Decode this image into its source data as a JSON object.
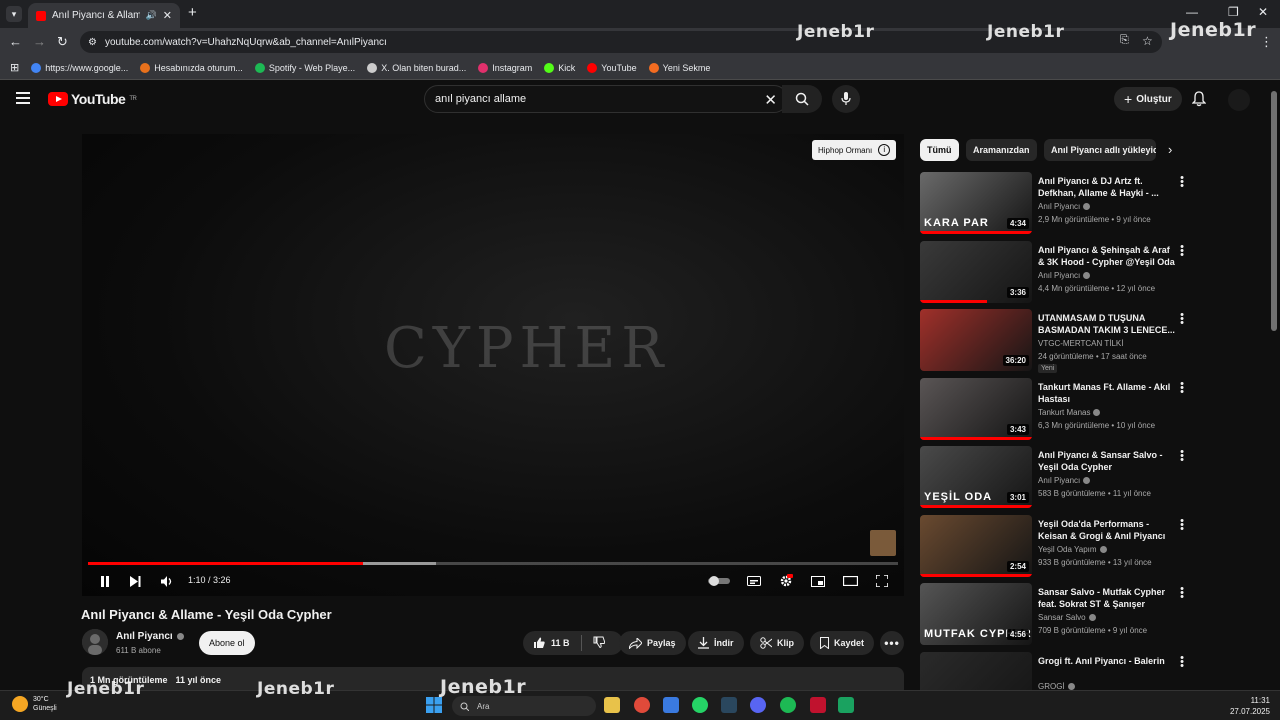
{
  "browser": {
    "tab_title": "Anıl Piyancı & Allame - Yeşi",
    "url": "youtube.com/watch?v=UhahzNqUqrw&ab_channel=AnılPiyancı",
    "bookmarks": [
      {
        "label": "https://www.google...",
        "icon": "google-icon",
        "color": "#4285f4"
      },
      {
        "label": "Hesabınızda oturum...",
        "icon": "office-icon",
        "color": "#e8711c"
      },
      {
        "label": "Spotify - Web Playe...",
        "icon": "spotify-icon",
        "color": "#1db954"
      },
      {
        "label": "X. Olan biten burad...",
        "icon": "x-icon",
        "color": "#cccccc"
      },
      {
        "label": "Instagram",
        "icon": "instagram-icon",
        "color": "#e1306c"
      },
      {
        "label": "Kick",
        "icon": "kick-icon",
        "color": "#53fc18"
      },
      {
        "label": "YouTube",
        "icon": "youtube-icon",
        "color": "#ff0000"
      },
      {
        "label": "Yeni Sekme",
        "icon": "hb-icon",
        "color": "#f36c21"
      }
    ]
  },
  "watermark": "Jeneb1r",
  "youtube": {
    "logo_text": "YouTube",
    "logo_region": "TR",
    "search_value": "anıl piyancı allame",
    "create_label": "Oluştur"
  },
  "player": {
    "overlay_text": "CYPHER",
    "chip_label": "Hiphop Ormanı",
    "time_current": "1:10",
    "time_total": "3:26",
    "played_fraction": 0.34,
    "buffered_fraction": 0.43
  },
  "video": {
    "title": "Anıl Piyancı & Allame - Yeşil Oda Cypher",
    "channel": "Anıl Piyancı",
    "subscribers": "611 B abone",
    "subscribe_label": "Abone ol",
    "likes": "11 B",
    "share_label": "Paylaş",
    "download_label": "İndir",
    "clip_label": "Klip",
    "save_label": "Kaydet",
    "views": "1 Mn görüntüleme",
    "age": "11 yıl önce"
  },
  "sidebar": {
    "chips": [
      "Tümü",
      "Aramanızdan",
      "Anıl Piyancı adlı yükleyic"
    ],
    "recommendations": [
      {
        "title": "Anıl Piyancı & DJ Artz ft. Defkhan, Allame & Hayki - ...",
        "channel": "Anıl Piyancı",
        "verified": true,
        "meta": "2,9 Mn görüntüleme • 9 yıl önce",
        "duration": "4:34",
        "thumb_color": "#6a6a6a",
        "thumb_text": "KARA PAR",
        "progress": 1.0
      },
      {
        "title": "Anıl Piyancı & Şehinşah & Araf & 3K Hood - Cypher @Yeşil Oda",
        "channel": "Anıl Piyancı",
        "verified": true,
        "meta": "4,4 Mn görüntüleme • 12 yıl önce",
        "duration": "3:36",
        "thumb_color": "#3a3a3a",
        "thumb_text": "",
        "progress": 0.6
      },
      {
        "title": "UTANMASAM D TUŞUNA BASMADAN TAKIM 3 LENECE...",
        "channel": "VTGC-MERTCAN TİLKİ",
        "verified": false,
        "meta": "24 görüntüleme • 17 saat önce",
        "duration": "36:20",
        "thumb_color": "#a0302a",
        "thumb_text": "",
        "progress": 0,
        "badge": "Yeni"
      },
      {
        "title": "Tankurt Manas Ft. Allame - Akıl Hastası",
        "channel": "Tankurt Manas",
        "verified": true,
        "meta": "6,3 Mn görüntüleme • 10 yıl önce",
        "duration": "3:43",
        "thumb_color": "#5a5555",
        "thumb_text": "",
        "progress": 1.0
      },
      {
        "title": "Anıl Piyancı & Sansar Salvo - Yeşil Oda Cypher",
        "channel": "Anıl Piyancı",
        "verified": true,
        "meta": "583 B görüntüleme • 11 yıl önce",
        "duration": "3:01",
        "thumb_color": "#4a4a4a",
        "thumb_text": "YEŞİL ODA",
        "progress": 1.0
      },
      {
        "title": "Yeşil Oda'da Performans - Keisan & Grogi & Anıl Piyancı",
        "channel": "Yeşil Oda Yapım",
        "verified": true,
        "meta": "933 B görüntüleme • 13 yıl önce",
        "duration": "2:54",
        "thumb_color": "#6a4a30",
        "thumb_text": "",
        "progress": 1.0
      },
      {
        "title": "Sansar Salvo - Mutfak Cypher feat. Sokrat ST & Şanışer",
        "channel": "Sansar Salvo",
        "verified": true,
        "meta": "709 B görüntüleme • 9 yıl önce",
        "duration": "4:56",
        "thumb_color": "#555555",
        "thumb_text": "MUTFAK CYPHER",
        "progress": 0
      },
      {
        "title": "Grogi ft. Anıl Piyancı - Balerin",
        "channel": "GROGİ",
        "verified": true,
        "meta": "",
        "duration": "",
        "thumb_color": "#2a2a2a",
        "thumb_text": "",
        "progress": 0
      }
    ]
  },
  "taskbar": {
    "temperature": "30°C",
    "weather": "Güneşli",
    "search_placeholder": "Ara",
    "time": "11:31",
    "date": "27.07.2025",
    "apps": [
      {
        "name": "windows-start-icon",
        "color": "#3aa0f0"
      },
      {
        "name": "file-explorer-icon",
        "color": "#e8c24a"
      },
      {
        "name": "chrome-icon",
        "color": "#e04a3a"
      },
      {
        "name": "photos-icon",
        "color": "#3a7ae0"
      },
      {
        "name": "whatsapp-icon",
        "color": "#25d366"
      },
      {
        "name": "steam-icon",
        "color": "#2a475e"
      },
      {
        "name": "discord-icon",
        "color": "#5865f2"
      },
      {
        "name": "spotify-icon",
        "color": "#1db954"
      },
      {
        "name": "app-red-icon",
        "color": "#c0122e"
      },
      {
        "name": "app-green-icon",
        "color": "#1aa260"
      }
    ]
  }
}
